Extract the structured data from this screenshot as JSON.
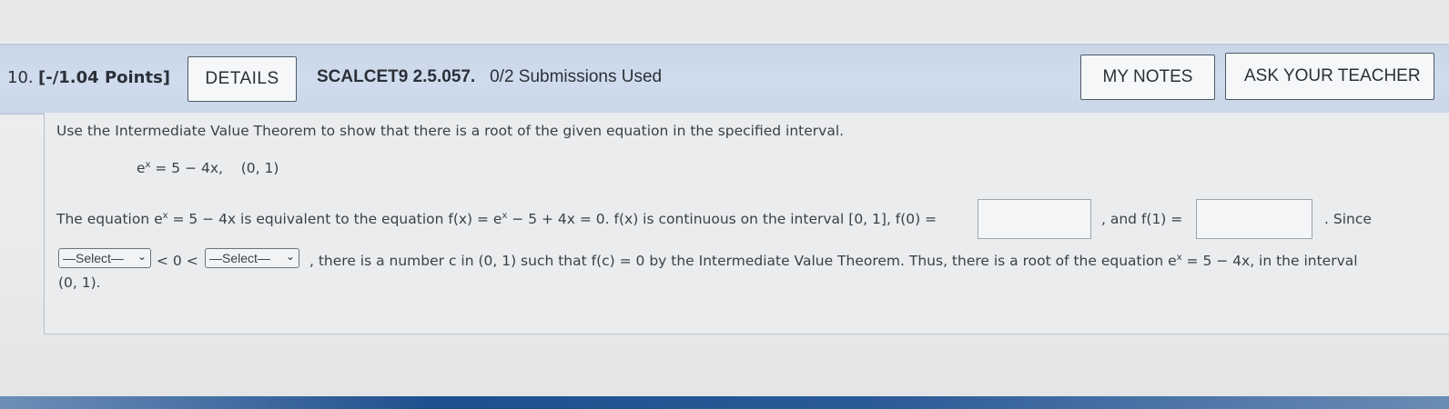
{
  "header": {
    "question_number": "10.",
    "points": "[-/1.04 Points]",
    "details_label": "DETAILS",
    "code": "SCALCET9 2.5.057.",
    "submissions": "0/2 Submissions Used",
    "my_notes_label": "MY NOTES",
    "ask_teacher_label": "ASK YOUR TEACHER"
  },
  "question": {
    "instruction": "Use the Intermediate Value Theorem to show that there is a root of the given equation in the specified interval.",
    "equation_base": "e",
    "equation_exp": "x",
    "equation_rest": " = 5 − 4x,",
    "interval": "(0, 1)",
    "line1_a": "The equation e",
    "line1_exp": "x",
    "line1_b": " = 5 − 4x is equivalent to the equation f(x) = e",
    "line1_exp2": "x",
    "line1_c": " − 5 + 4x = 0. f(x) is continuous on the interval [0, 1], f(0) =",
    "line1_and": ", and f(1) =",
    "line1_since": ". Since",
    "select_placeholder": "—Select—",
    "ineq": "< 0 <",
    "line2_a": ", there is a number c in (0, 1) such that f(c) = 0 by the Intermediate Value Theorem. Thus, there is a root of the equation e",
    "line2_exp": "x",
    "line2_b": " = 5 − 4x, in the interval",
    "line3": "(0, 1)."
  }
}
